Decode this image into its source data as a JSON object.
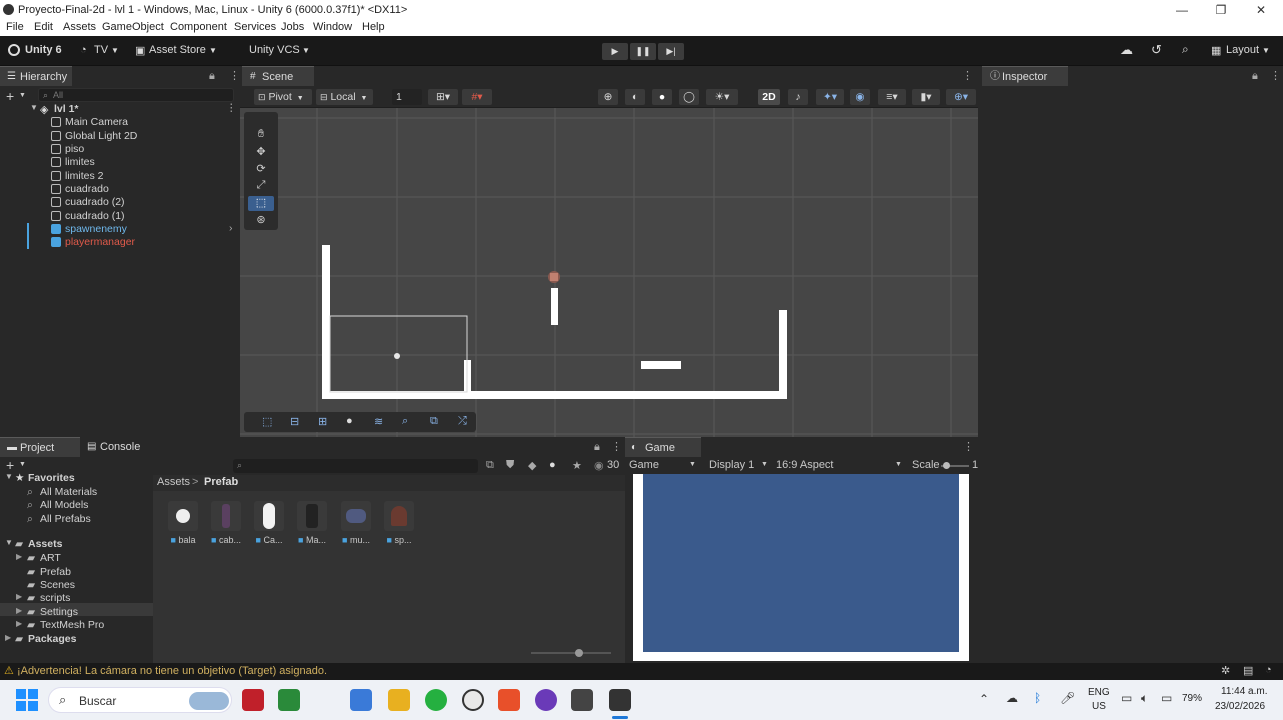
{
  "window": {
    "title": "Proyecto-Final-2d - lvl 1 - Windows, Mac, Linux - Unity 6 (6000.0.37f1)* <DX11>"
  },
  "menu": [
    "File",
    "Edit",
    "Assets",
    "GameObject",
    "Component",
    "Services",
    "Jobs",
    "Window",
    "Help"
  ],
  "toolbar": {
    "unity_label": "Unity 6",
    "account_label": "TV",
    "asset_store_label": "Asset Store",
    "vcs_label": "Unity VCS",
    "layout_label": "Layout"
  },
  "hierarchy": {
    "tab_label": "Hierarchy",
    "search_placeholder": "All",
    "scene_name": "lvl 1*",
    "items": [
      {
        "label": "Main Camera"
      },
      {
        "label": "Global Light 2D"
      },
      {
        "label": "piso"
      },
      {
        "label": "limites"
      },
      {
        "label": "limites 2"
      },
      {
        "label": "cuadrado"
      },
      {
        "label": "cuadrado (2)"
      },
      {
        "label": "cuadrado (1)"
      },
      {
        "label": "spawnenemy"
      },
      {
        "label": "playermanager"
      }
    ]
  },
  "scene": {
    "tab_label": "Scene",
    "pivot_label": "Pivot",
    "space_label": "Local",
    "snap_value": "1",
    "mode_2d_label": "2D"
  },
  "inspector": {
    "tab_label": "Inspector"
  },
  "project": {
    "tab_label": "Project",
    "console_tab_label": "Console",
    "hidden_count": "30",
    "breadcrumb_root": "Assets",
    "breadcrumb_sep": ">",
    "breadcrumb_current": "Prefab",
    "favorites_label": "Favorites",
    "favorites": [
      "All Materials",
      "All Models",
      "All Prefabs"
    ],
    "assets_label": "Assets",
    "folders": [
      "ART",
      "Prefab",
      "Scenes",
      "scripts",
      "Settings",
      "TextMesh Pro"
    ],
    "packages_label": "Packages",
    "assets": [
      {
        "label": "bala"
      },
      {
        "label": "cab..."
      },
      {
        "label": "Ca..."
      },
      {
        "label": "Ma..."
      },
      {
        "label": "mu..."
      },
      {
        "label": "sp..."
      }
    ]
  },
  "game": {
    "tab_label": "Game",
    "mode_label": "Game",
    "display_label": "Display 1",
    "aspect_label": "16:9 Aspect",
    "scale_label": "Scale",
    "scale_value": "1"
  },
  "status": {
    "message": "¡Advertencia! La cámara no tiene un objetivo (Target) asignado."
  },
  "taskbar": {
    "search_label": "Buscar",
    "lang_line1": "ENG",
    "lang_line2": "US",
    "battery": "79%",
    "time": "11:44 a.m.",
    "date": "23/02/2026"
  },
  "colors": {
    "accent_blue": "#4aa3df",
    "player_red": "#e05a4a",
    "game_bg": "#3a5a8c"
  }
}
